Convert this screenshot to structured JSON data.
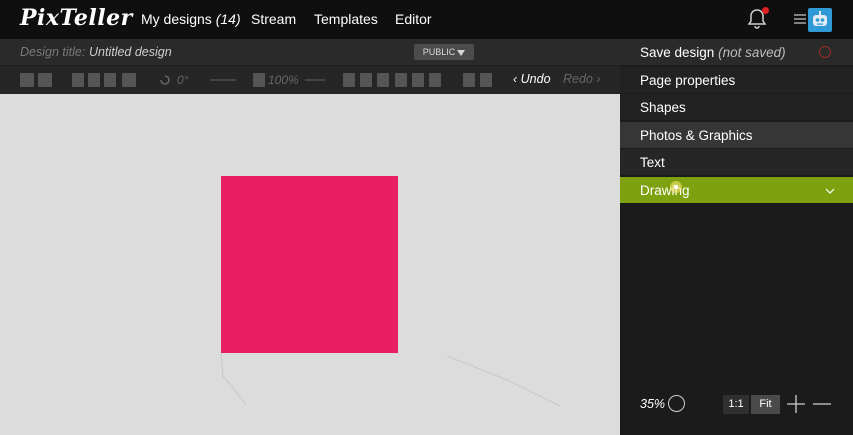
{
  "header": {
    "logo": "PixTeller",
    "nav": {
      "my_designs": "My designs",
      "my_designs_count": "(14)",
      "stream": "Stream",
      "templates": "Templates",
      "editor": "Editor"
    },
    "icons": {
      "bell": "bell-icon",
      "menu": "hamburger-icon",
      "avatar": "robot-avatar"
    }
  },
  "design": {
    "title_label": "Design title:",
    "title_value": "Untitled design",
    "visibility": "PUBLIC"
  },
  "toolbar": {
    "rotation": "0°",
    "opacity": "100%",
    "undo": "Undo",
    "redo": "Redo"
  },
  "panel": {
    "items": [
      {
        "label": "Save design",
        "sub": "(not saved)"
      },
      {
        "label": "Page properties"
      },
      {
        "label": "Shapes"
      },
      {
        "label": "Photos & Graphics"
      },
      {
        "label": "Text"
      },
      {
        "label": "Drawing"
      }
    ]
  },
  "zoom": {
    "level": "35%",
    "actual_size": "1:1",
    "fit": "Fit"
  },
  "colors": {
    "accent": "#7ea10f",
    "shape_fill": "#e91e63",
    "canvas_bg": "#dcdcdc"
  }
}
